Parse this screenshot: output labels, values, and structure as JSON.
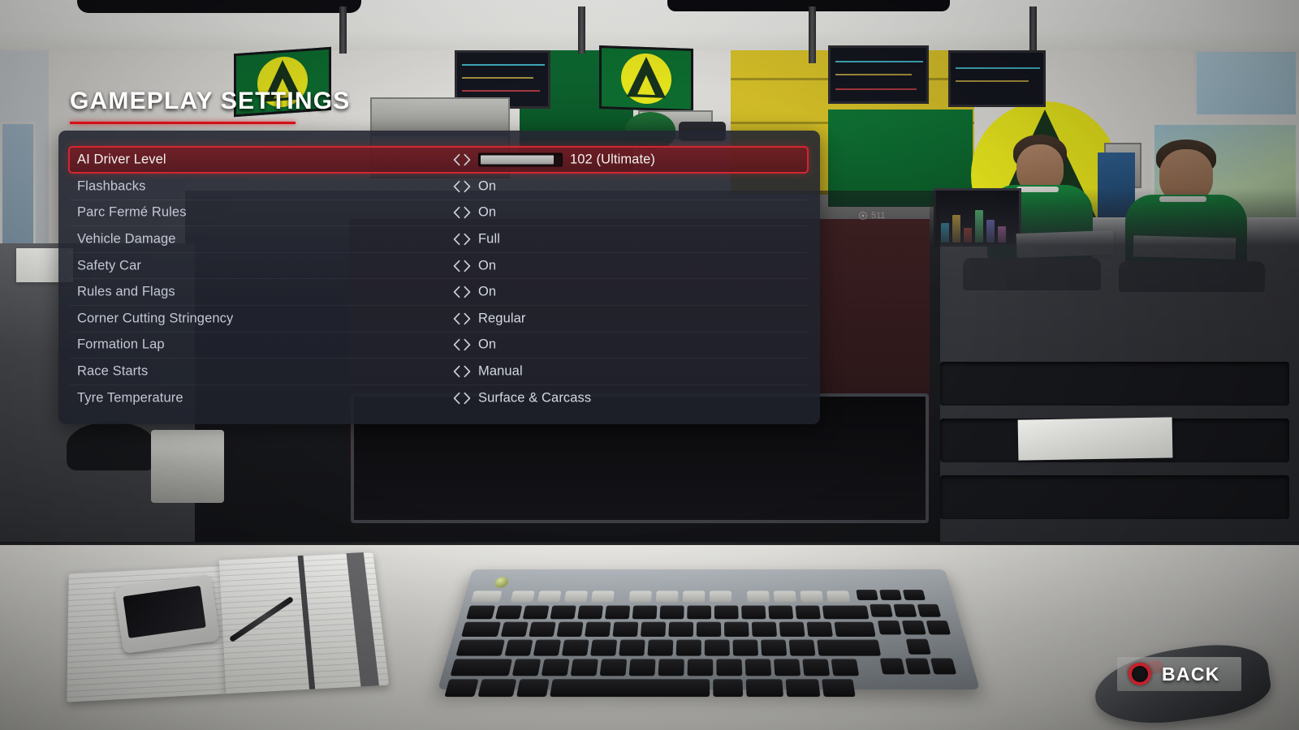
{
  "screen": {
    "title": "GAMEPLAY SETTINGS",
    "accent_red": "#e01019",
    "selected_row_border": "#d42630",
    "panel_bg": "#242732"
  },
  "settings": {
    "rows": [
      {
        "label": "AI Driver Level",
        "value": "102 (Ultimate)",
        "control": "slider",
        "slider_percent": 92,
        "selected": true
      },
      {
        "label": "Flashbacks",
        "value": "On",
        "control": "stepper",
        "selected": false
      },
      {
        "label": "Parc Fermé Rules",
        "value": "On",
        "control": "stepper",
        "selected": false
      },
      {
        "label": "Vehicle Damage",
        "value": "Full",
        "control": "stepper",
        "selected": false
      },
      {
        "label": "Safety Car",
        "value": "On",
        "control": "stepper",
        "selected": false
      },
      {
        "label": "Rules and Flags",
        "value": "On",
        "control": "stepper",
        "selected": false
      },
      {
        "label": "Corner Cutting Stringency",
        "value": "Regular",
        "control": "stepper",
        "selected": false
      },
      {
        "label": "Formation Lap",
        "value": "On",
        "control": "stepper",
        "selected": false
      },
      {
        "label": "Race Starts",
        "value": "Manual",
        "control": "stepper",
        "selected": false
      },
      {
        "label": "Tyre Temperature",
        "value": "Surface & Carcass",
        "control": "stepper",
        "selected": false
      }
    ]
  },
  "hud": {
    "counter": "511"
  },
  "footer": {
    "back_label": "BACK",
    "back_icon": "circle-button-icon"
  }
}
